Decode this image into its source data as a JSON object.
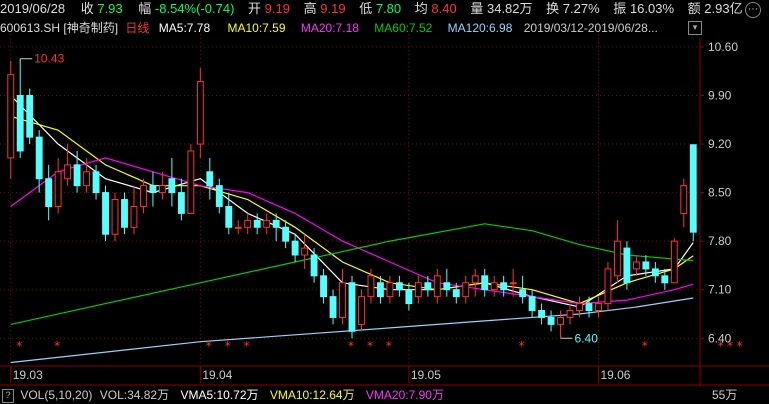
{
  "header": {
    "date": "2019/06/28",
    "close_label": "收",
    "close_value": "7.93",
    "change_label": "幅",
    "change_value": "-8.54%(-0.74)",
    "open_label": "开",
    "open_value": "9.19",
    "high_label": "高",
    "high_value": "9.19",
    "low_label": "低",
    "low_value": "7.80",
    "avg_label": "均",
    "avg_value": "8.40",
    "volume_label": "量",
    "volume_value": "34.82万",
    "turnover_label": "换",
    "turnover_value": "7.27%",
    "amplitude_label": "振",
    "amplitude_value": "16.03%",
    "amount_label": "额",
    "amount_value": "2.93亿",
    "more_icon": "ellipsis-icon"
  },
  "ma_bar": {
    "stock": "600613.SH [神奇制药]",
    "period": "日线",
    "ma5": "MA5:7.78",
    "ma10": "MA10:7.59",
    "ma20": "MA20:7.18",
    "ma60": "MA60:7.52",
    "ma120": "MA120:6.98",
    "range": "2019/03/12-2019/06/28...",
    "expand_icon": "chevron-down-icon"
  },
  "volume_bar": {
    "help": "?",
    "vol": "VOL(5,10,20)",
    "vol_value": "VOL:34.82万",
    "vma5": "VMA5:10.72万",
    "vma10": "VMA10:12.64万",
    "vma20": "VMA20:7.90万",
    "right_label": "55万"
  },
  "colors": {
    "up": "#ff3232",
    "down": "#54ffff",
    "ma5": "#ffffff",
    "ma10": "#ffff00",
    "ma20": "#ff00ff",
    "ma60": "#00cc00",
    "ma120": "#8fd4ff",
    "grid": "#8b0000"
  },
  "chart_data": {
    "type": "candlestick",
    "y_ticks": [
      "10.60",
      "9.90",
      "9.20",
      "8.50",
      "7.80",
      "7.10",
      "6.40"
    ],
    "ylim": [
      6.0,
      10.7
    ],
    "x_ticks": [
      "19.03",
      "19.04",
      "19.05",
      "19.06"
    ],
    "annotations": [
      {
        "text": "10.43",
        "value": 10.43,
        "index": 1,
        "color": "#ff3232"
      },
      {
        "text": "6.40",
        "value": 6.4,
        "index": 58,
        "color": "#54ffff"
      }
    ],
    "candles": [
      [
        9.0,
        10.2,
        8.7,
        10.4
      ],
      [
        9.9,
        9.1,
        9.0,
        10.43
      ],
      [
        9.9,
        9.3,
        9.2,
        10.0
      ],
      [
        9.3,
        8.7,
        8.5,
        9.4
      ],
      [
        8.7,
        8.3,
        8.1,
        8.9
      ],
      [
        8.3,
        8.8,
        8.2,
        9.0
      ],
      [
        8.7,
        8.9,
        8.6,
        9.2
      ],
      [
        8.9,
        8.6,
        8.5,
        9.1
      ],
      [
        8.6,
        8.8,
        8.5,
        9.0
      ],
      [
        8.8,
        8.5,
        8.4,
        8.9
      ],
      [
        8.5,
        7.9,
        7.8,
        8.6
      ],
      [
        7.9,
        8.4,
        7.8,
        8.5
      ],
      [
        8.4,
        8.0,
        7.9,
        8.5
      ],
      [
        8.0,
        8.3,
        7.9,
        8.6
      ],
      [
        8.3,
        8.6,
        8.2,
        8.7
      ],
      [
        8.6,
        8.5,
        8.3,
        8.8
      ],
      [
        8.5,
        8.6,
        8.4,
        8.8
      ],
      [
        8.7,
        8.5,
        8.3,
        9.0
      ],
      [
        8.5,
        8.2,
        8.1,
        8.7
      ],
      [
        8.2,
        9.1,
        8.2,
        9.2
      ],
      [
        9.2,
        10.1,
        9.0,
        10.3
      ],
      [
        8.8,
        8.6,
        8.4,
        9.0
      ],
      [
        8.6,
        8.3,
        8.2,
        8.7
      ],
      [
        8.3,
        8.0,
        7.9,
        8.5
      ],
      [
        8.0,
        8.0,
        7.9,
        8.1
      ],
      [
        8.0,
        8.1,
        7.9,
        8.2
      ],
      [
        8.1,
        8.0,
        7.9,
        8.2
      ],
      [
        8.0,
        8.1,
        7.9,
        8.2
      ],
      [
        8.1,
        8.0,
        7.8,
        8.2
      ],
      [
        8.0,
        7.8,
        7.7,
        8.1
      ],
      [
        7.8,
        7.6,
        7.5,
        7.9
      ],
      [
        7.6,
        7.7,
        7.4,
        7.9
      ],
      [
        7.6,
        7.3,
        7.2,
        7.7
      ],
      [
        7.3,
        7.0,
        6.9,
        7.4
      ],
      [
        7.0,
        6.7,
        6.6,
        7.1
      ],
      [
        6.7,
        7.2,
        6.6,
        7.4
      ],
      [
        7.2,
        6.5,
        6.4,
        7.3
      ],
      [
        6.6,
        7.0,
        6.5,
        7.1
      ],
      [
        7.0,
        7.3,
        6.9,
        7.4
      ],
      [
        7.2,
        7.0,
        6.9,
        7.3
      ],
      [
        7.0,
        7.2,
        6.9,
        7.3
      ],
      [
        7.2,
        7.1,
        7.0,
        7.3
      ],
      [
        7.1,
        6.9,
        6.8,
        7.2
      ],
      [
        7.0,
        7.2,
        6.9,
        7.3
      ],
      [
        7.2,
        7.1,
        7.0,
        7.3
      ],
      [
        7.0,
        7.3,
        6.9,
        7.4
      ],
      [
        7.2,
        7.1,
        7.0,
        7.4
      ],
      [
        7.1,
        7.0,
        6.9,
        7.2
      ],
      [
        7.0,
        7.2,
        6.9,
        7.3
      ],
      [
        7.2,
        7.3,
        7.0,
        7.4
      ],
      [
        7.3,
        7.1,
        7.0,
        7.4
      ],
      [
        7.1,
        7.2,
        7.0,
        7.3
      ],
      [
        7.2,
        7.1,
        7.0,
        7.3
      ],
      [
        7.2,
        7.2,
        7.0,
        7.4
      ],
      [
        7.1,
        7.0,
        6.9,
        7.3
      ],
      [
        7.0,
        6.8,
        6.7,
        7.1
      ],
      [
        6.8,
        6.7,
        6.6,
        6.9
      ],
      [
        6.7,
        6.6,
        6.5,
        6.8
      ],
      [
        6.6,
        6.7,
        6.4,
        6.8
      ],
      [
        6.7,
        6.8,
        6.6,
        6.9
      ],
      [
        6.8,
        6.9,
        6.7,
        7.0
      ],
      [
        6.9,
        6.8,
        6.7,
        7.0
      ],
      [
        6.8,
        6.9,
        6.7,
        7.0
      ],
      [
        6.9,
        7.4,
        6.8,
        7.5
      ],
      [
        7.3,
        7.8,
        7.2,
        8.1
      ],
      [
        7.7,
        7.2,
        7.1,
        7.8
      ],
      [
        7.4,
        7.5,
        7.3,
        7.6
      ],
      [
        7.5,
        7.4,
        7.3,
        7.6
      ],
      [
        7.4,
        7.3,
        7.2,
        7.5
      ],
      [
        7.3,
        7.2,
        7.1,
        7.4
      ],
      [
        7.2,
        7.8,
        7.2,
        7.85
      ],
      [
        8.2,
        8.6,
        8.0,
        8.7
      ],
      [
        9.19,
        7.93,
        7.8,
        9.19
      ]
    ],
    "ma_lines": {
      "MA5": [
        [
          0,
          9.9
        ],
        [
          5,
          9.2
        ],
        [
          10,
          8.7
        ],
        [
          15,
          8.5
        ],
        [
          20,
          8.7
        ],
        [
          25,
          8.2
        ],
        [
          30,
          7.9
        ],
        [
          35,
          7.2
        ],
        [
          40,
          7.1
        ],
        [
          45,
          7.1
        ],
        [
          50,
          7.2
        ],
        [
          55,
          7.0
        ],
        [
          60,
          6.85
        ],
        [
          65,
          7.3
        ],
        [
          70,
          7.4
        ],
        [
          72,
          7.78
        ]
      ],
      "MA10": [
        [
          0,
          9.6
        ],
        [
          5,
          9.4
        ],
        [
          10,
          8.9
        ],
        [
          15,
          8.6
        ],
        [
          20,
          8.6
        ],
        [
          25,
          8.4
        ],
        [
          30,
          8.0
        ],
        [
          35,
          7.5
        ],
        [
          40,
          7.2
        ],
        [
          45,
          7.1
        ],
        [
          50,
          7.2
        ],
        [
          55,
          7.1
        ],
        [
          60,
          6.9
        ],
        [
          65,
          7.2
        ],
        [
          70,
          7.4
        ],
        [
          72,
          7.59
        ]
      ],
      "MA20": [
        [
          0,
          8.3
        ],
        [
          5,
          8.8
        ],
        [
          10,
          9.0
        ],
        [
          15,
          8.8
        ],
        [
          20,
          8.6
        ],
        [
          25,
          8.5
        ],
        [
          30,
          8.2
        ],
        [
          35,
          7.8
        ],
        [
          40,
          7.5
        ],
        [
          45,
          7.2
        ],
        [
          50,
          7.1
        ],
        [
          55,
          7.0
        ],
        [
          60,
          6.9
        ],
        [
          65,
          6.95
        ],
        [
          70,
          7.1
        ],
        [
          72,
          7.18
        ]
      ],
      "MA60": [
        [
          0,
          6.6
        ],
        [
          10,
          6.9
        ],
        [
          20,
          7.2
        ],
        [
          30,
          7.5
        ],
        [
          40,
          7.8
        ],
        [
          50,
          8.05
        ],
        [
          55,
          7.95
        ],
        [
          60,
          7.75
        ],
        [
          65,
          7.6
        ],
        [
          72,
          7.52
        ]
      ],
      "MA120": [
        [
          0,
          6.05
        ],
        [
          10,
          6.2
        ],
        [
          20,
          6.35
        ],
        [
          30,
          6.45
        ],
        [
          40,
          6.55
        ],
        [
          50,
          6.65
        ],
        [
          60,
          6.75
        ],
        [
          66,
          6.85
        ],
        [
          72,
          6.98
        ]
      ]
    },
    "star_indices": [
      1,
      5,
      21,
      23,
      25,
      36,
      38,
      40,
      54,
      67,
      75,
      76,
      77
    ]
  }
}
